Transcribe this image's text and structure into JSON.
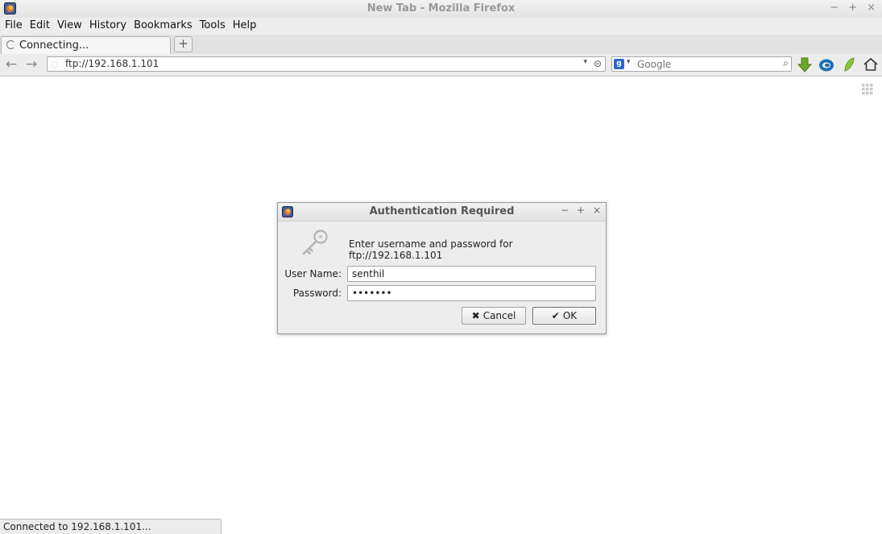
{
  "window": {
    "title": "New Tab - Mozilla Firefox",
    "controls": [
      "−",
      "+",
      "×"
    ]
  },
  "menu": {
    "items": [
      "File",
      "Edit",
      "View",
      "History",
      "Bookmarks",
      "Tools",
      "Help"
    ]
  },
  "tabs": {
    "active_label": "Connecting...",
    "new_tab_label": "+"
  },
  "nav": {
    "back": "←",
    "forward": "→",
    "url": "ftp://192.168.1.101",
    "dropdown": "▾",
    "stop": "⊝",
    "search_engine_letter": "g",
    "search_dropdown": "▾",
    "search_placeholder": "Google",
    "search_go": "⌕"
  },
  "dialog": {
    "title": "Authentication Required",
    "controls": [
      "−",
      "+",
      "×"
    ],
    "message": "Enter username and password for ftp://192.168.1.101",
    "username_label": "User Name:",
    "username_value": "senthil",
    "password_label": "Password:",
    "password_value": "*******",
    "cancel_label": "Cancel",
    "cancel_glyph": "✖",
    "ok_label": "OK",
    "ok_glyph": "✔"
  },
  "status": {
    "text": "Connected to 192.168.1.101..."
  },
  "colors": {
    "chrome_bg": "#ececec",
    "download_green": "#6aa82a",
    "globe_blue": "#1e6fb3",
    "leaf_green": "#8cc63f"
  }
}
